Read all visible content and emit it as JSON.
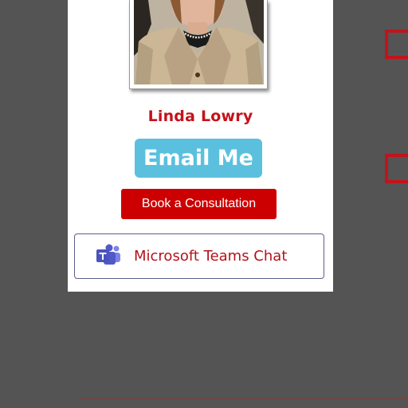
{
  "profile": {
    "name": "Linda Lowry",
    "photo_alt": "Linda Lowry headshot"
  },
  "buttons": {
    "email": "Email Me",
    "book": "Book a Consultation",
    "teams": "Microsoft Teams Chat"
  },
  "icons": {
    "teams": "microsoft-teams-icon"
  },
  "colors": {
    "page_background": "#545454",
    "card_background": "#ffffff",
    "name_red": "#c4121b",
    "email_blue": "#5bc0de",
    "book_red": "#cc0000",
    "teams_purple": "#5059c9",
    "teams_text": "#b3131c"
  }
}
